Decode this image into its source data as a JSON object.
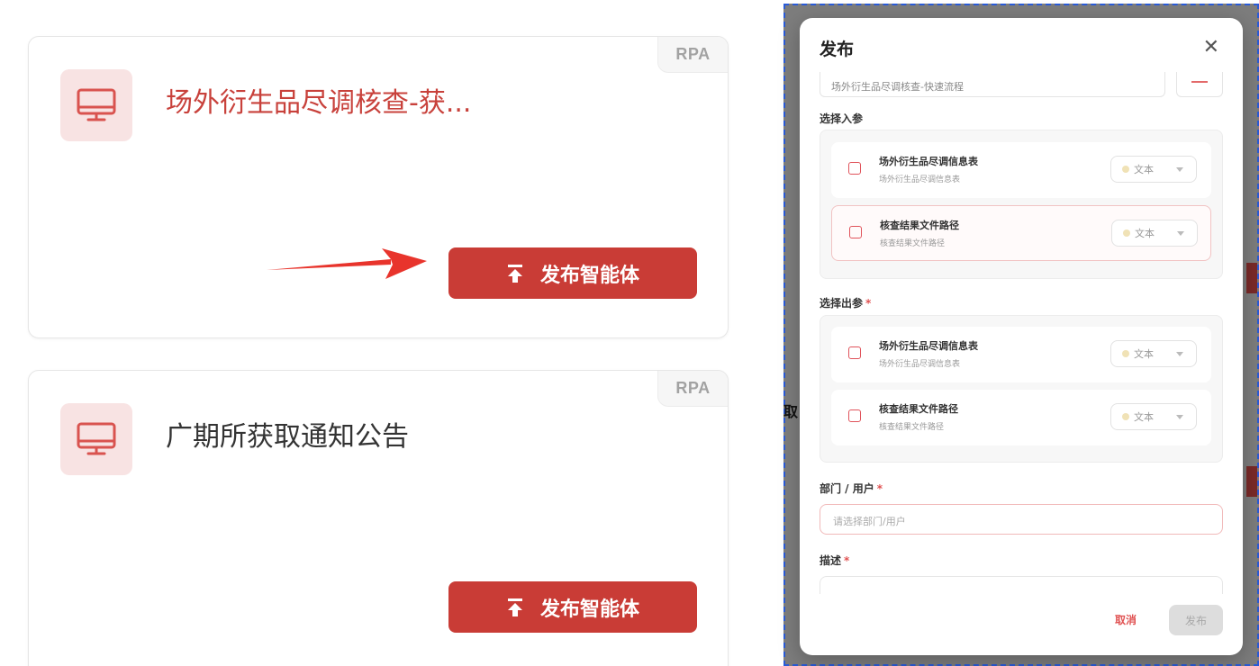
{
  "cards": [
    {
      "tag": "RPA",
      "title": "场外衍生品尽调核查-获...",
      "button_label": "发布智能体",
      "icon": "monitor-icon"
    },
    {
      "tag": "RPA",
      "title": "广期所获取通知公告",
      "button_label": "发布智能体",
      "icon": "monitor-icon"
    }
  ],
  "edge_text": "取",
  "modal": {
    "title": "发布",
    "close": "✕",
    "workflow_value": "场外衍生品尽调核查-快速流程",
    "inputs_label": "选择入参",
    "outputs_label": "选择出参",
    "required_mark": "*",
    "inputs": [
      {
        "name": "场外衍生品尽调信息表",
        "desc": "场外衍生品尽调信息表",
        "type": "文本"
      },
      {
        "name": "核查结果文件路径",
        "desc": "核查结果文件路径",
        "type": "文本"
      }
    ],
    "outputs": [
      {
        "name": "场外衍生品尽调信息表",
        "desc": "场外衍生品尽调信息表",
        "type": "文本"
      },
      {
        "name": "核查结果文件路径",
        "desc": "核查结果文件路径",
        "type": "文本"
      }
    ],
    "dept_label": "部门 / 用户",
    "dept_placeholder": "请选择部门/用户",
    "desc_label": "描述",
    "cancel_label": "取消",
    "submit_label": "发布"
  },
  "colors": {
    "accent": "#c93c36",
    "accent_light": "#f8e3e3",
    "overlay": "#7d7d7d"
  }
}
